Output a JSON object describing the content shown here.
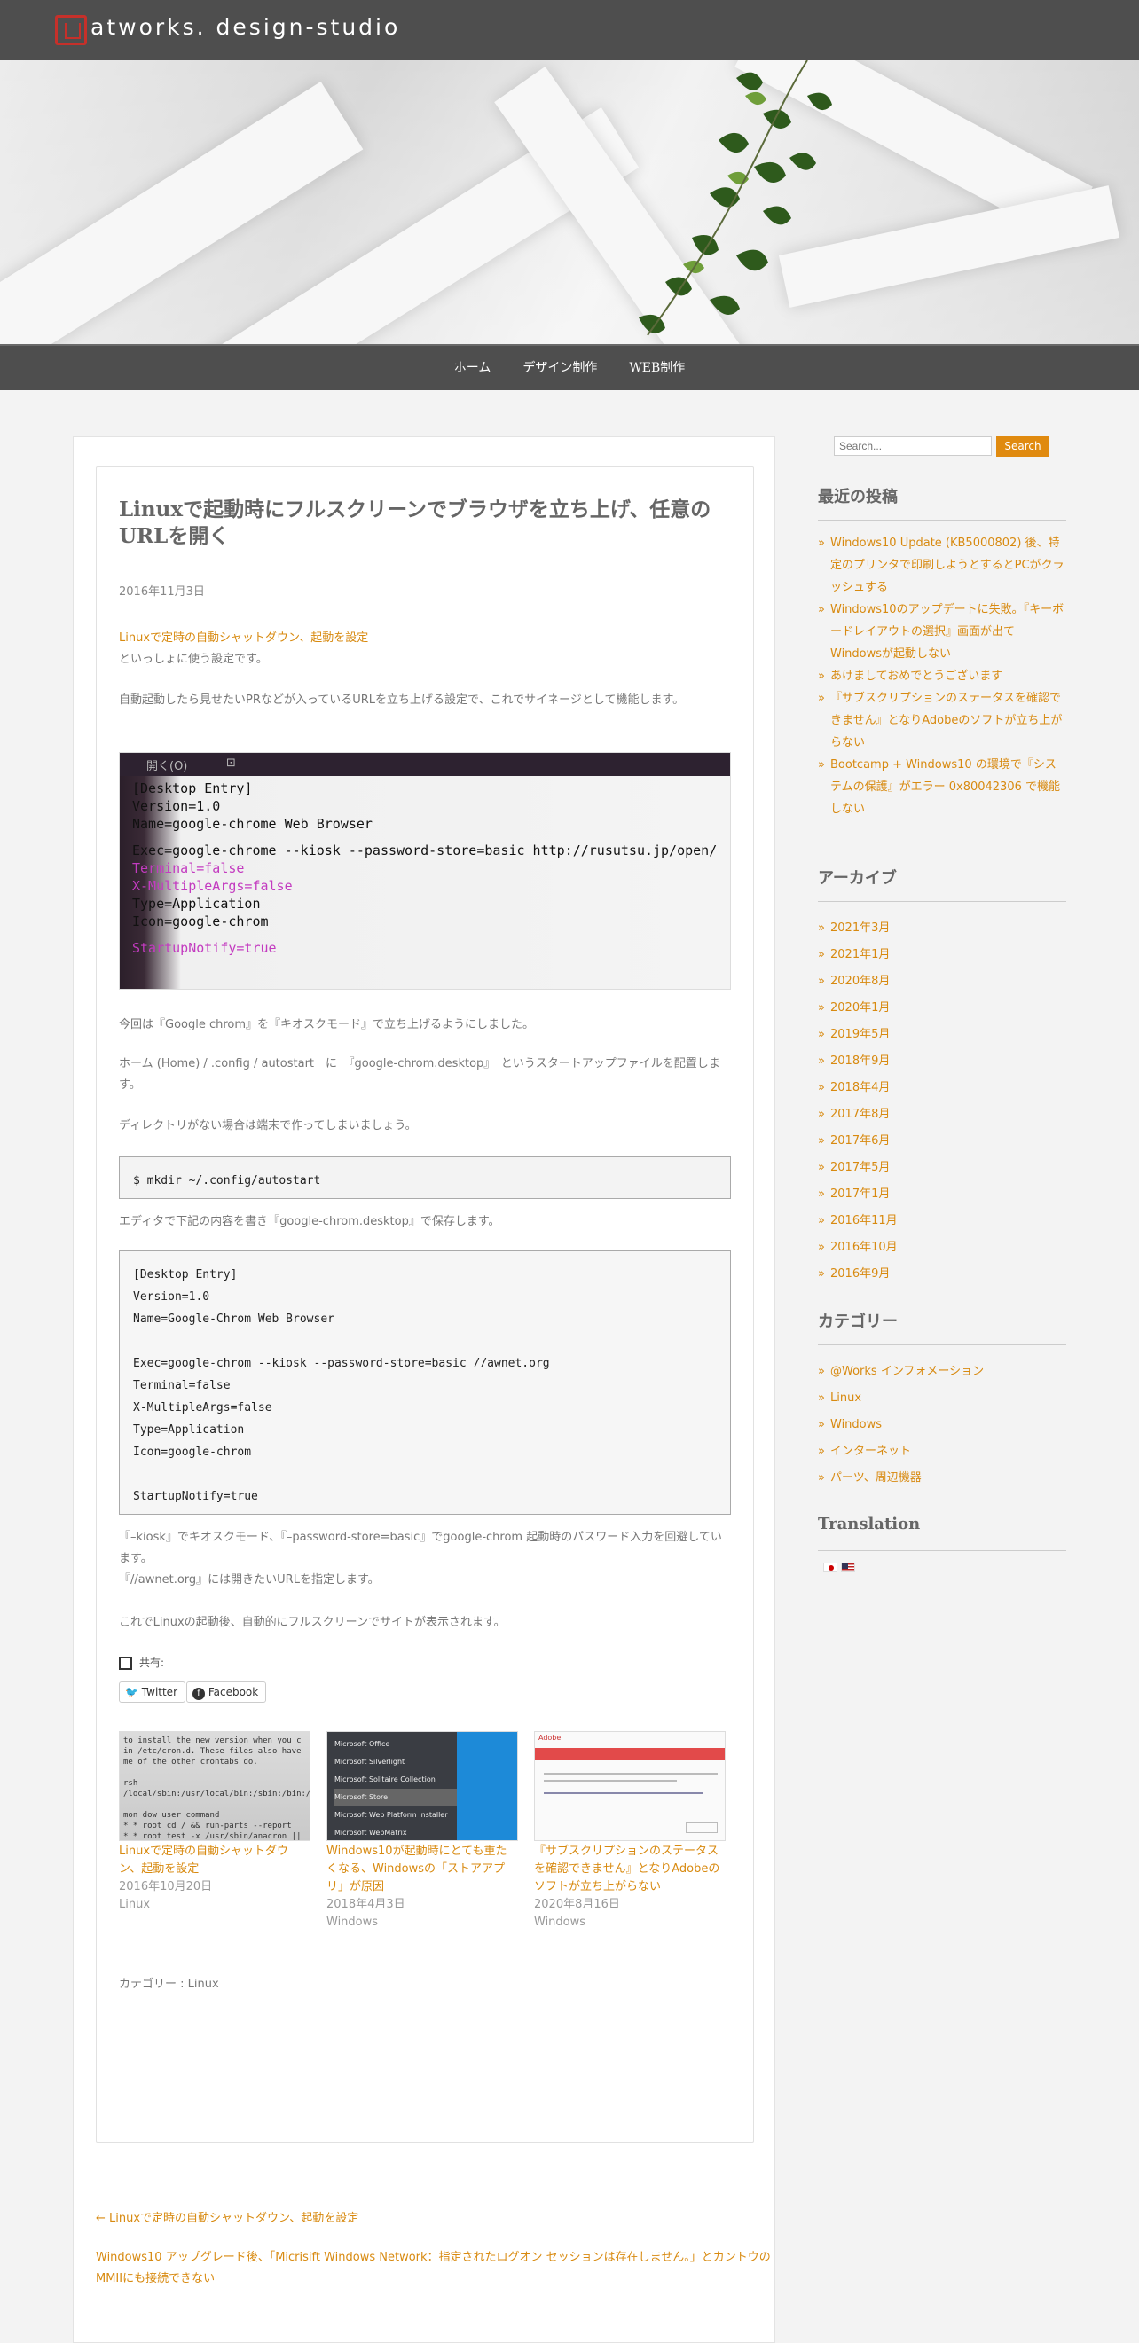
{
  "site": {
    "logo_text": "atworks. design-studio",
    "nav": [
      "ホーム",
      "デザイン制作",
      "WEB制作"
    ]
  },
  "post": {
    "title": "Linuxで起動時にフルスクリーンでブラウザを立ち上げ、任意のURLを開く",
    "date": "2016年11月3日",
    "intro_link": "Linuxで定時の自動シャットダウン、起動を設定",
    "intro_text": "といっしょに使う設定です。",
    "para1": "自動起動したら見せたいPRなどが入っているURLを立ち上げる設定で、これでサイネージとして機能します。",
    "screenshot": {
      "menu_open": "開く(O)",
      "lines": [
        "[Desktop Entry]",
        "Version=1.0",
        "Name=google-chrome Web Browser",
        "",
        "Exec=google-chrome --kiosk --password-store=basic http://rusutsu.jp/open/",
        "Terminal=false",
        "X-MultipleArgs=false",
        "Type=Application",
        "Icon=google-chrom",
        "",
        "StartupNotify=true"
      ]
    },
    "para2": "今回は『Google chrom』を『キオスクモード』で立ち上げるようにしました。",
    "para3": "ホーム (Home) / .config / autostart　に　『google-chrom.desktop』　というスタートアップファイルを配置します。",
    "para4": "ディレクトリがない場合は端末で作ってしまいましょう。",
    "code1": "$ mkdir ~/.config/autostart",
    "para5": "エディタで下記の内容を書き『google-chrom.desktop』で保存します。",
    "code2": [
      "[Desktop Entry]",
      "Version=1.0",
      "Name=Google-Chrom Web Browser",
      "",
      "Exec=google-chrom --kiosk --password-store=basic //awnet.org",
      "Terminal=false",
      "X-MultipleArgs=false",
      "Type=Application",
      "Icon=google-chrom",
      "",
      "StartupNotify=true"
    ],
    "para6a": "『–kiosk』でキオスクモード、『–password-store=basic』でgoogle-chrom 起動時のパスワード入力を回避しています。",
    "para6b": "『//awnet.org』には開きたいURLを指定します。",
    "para7": "これでLinuxの起動後、自動的にフルスクリーンでサイトが表示されます。",
    "share_label": "共有:",
    "share_buttons": [
      "Twitter",
      "Facebook"
    ],
    "related": [
      {
        "title": "Linuxで定時の自動シャットダウン、起動を設定",
        "date": "2016年10月20日",
        "category": "Linux"
      },
      {
        "title": "Windows10が起動時にとても重たくなる、Windowsの「ストアアプリ」が原因",
        "date": "2018年4月3日",
        "category": "Windows"
      },
      {
        "title": "『サブスクリプションのステータスを確認できません』となりAdobeのソフトが立ち上がらない",
        "date": "2020年8月16日",
        "category": "Windows"
      }
    ],
    "category_line": "カテゴリー : Linux",
    "prev_link": "← Linuxで定時の自動シャットダウン、起動を設定",
    "next_link": "Windows10 アップグレード後、「Micrisift Windows Network：指定されたログオン セッションは存在しません。」とカントウのMMIIにも接続できない"
  },
  "sidebar": {
    "search_placeholder": "Search...",
    "search_button": "Search",
    "recent_title": "最近の投稿",
    "recent": [
      "Windows10 Update (KB5000802) 後、特定のプリンタで印刷しようとするとPCがクラッシュする",
      "Windows10のアップデートに失敗。『キーボードレイアウトの選択』画面が出てWindowsが起動しない",
      "あけましておめでとうございます",
      "『サブスクリプションのステータスを確認できません』となりAdobeのソフトが立ち上がらない",
      "Bootcamp + Windows10 の環境で『システムの保護』がエラー 0x80042306 で機能しない"
    ],
    "archive_title": "アーカイブ",
    "archives": [
      "2021年3月",
      "2021年1月",
      "2020年8月",
      "2020年1月",
      "2019年5月",
      "2018年9月",
      "2018年4月",
      "2017年8月",
      "2017年6月",
      "2017年5月",
      "2017年1月",
      "2016年11月",
      "2016年10月",
      "2016年9月"
    ],
    "category_title": "カテゴリー",
    "categories": [
      "@Works インフォメーション",
      "Linux",
      "Windows",
      "インターネット",
      "パーツ、周辺機器"
    ],
    "translation_title": "Translation"
  },
  "colors": {
    "accent": "#e08a0f",
    "topbar": "#4e4e4e",
    "logo": "#c6302a"
  }
}
